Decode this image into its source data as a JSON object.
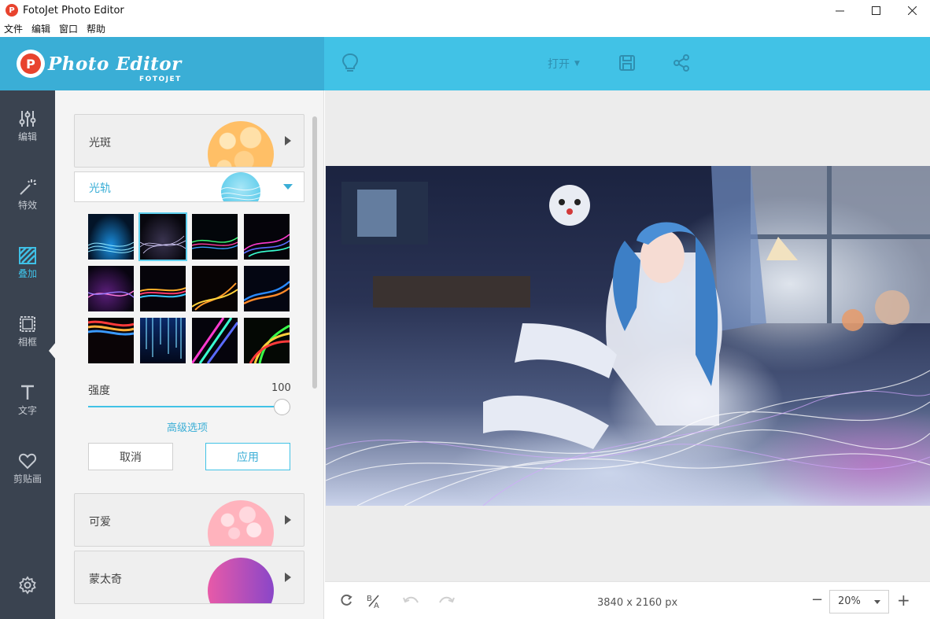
{
  "window": {
    "title": "FotoJet Photo Editor",
    "app_icon": "P"
  },
  "menu": [
    "文件",
    "编辑",
    "窗口",
    "帮助"
  ],
  "header": {
    "logo_letter": "P",
    "logo_title": "Photo Editor",
    "logo_sub": "FOTOJET",
    "open_label": "打开",
    "accent": "#41c2e6",
    "icons": [
      "lightbulb-icon",
      "save-icon",
      "share-icon"
    ]
  },
  "nav": [
    {
      "label": "编辑",
      "icon": "sliders-icon",
      "active": false
    },
    {
      "label": "特效",
      "icon": "magic-wand-icon",
      "active": false
    },
    {
      "label": "叠加",
      "icon": "overlay-icon",
      "active": true
    },
    {
      "label": "相框",
      "icon": "frame-icon",
      "active": false
    },
    {
      "label": "文字",
      "icon": "text-icon",
      "active": false
    },
    {
      "label": "剪贴画",
      "icon": "heart-icon",
      "active": false
    }
  ],
  "panel": {
    "categories": {
      "bokeh": "光斑",
      "light_trails": "光轨",
      "cute": "可爱",
      "montage": "蒙太奇"
    },
    "selected_tile": 2,
    "tile_count": 12,
    "strength_label": "强度",
    "strength_value": "100",
    "strength_fraction": 1.0,
    "advanced": "高级选项",
    "cancel": "取消",
    "apply": "应用"
  },
  "footer": {
    "dimensions": "3840 x 2160 px",
    "zoom": "20%"
  }
}
